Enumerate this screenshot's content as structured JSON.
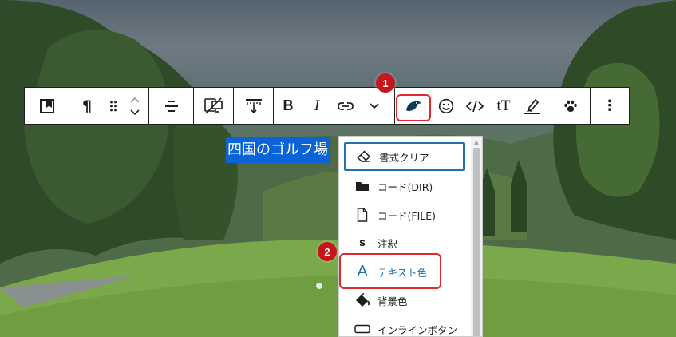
{
  "background": {
    "description_icon": "golf-course-photo"
  },
  "toolbar": {
    "groups": [
      {
        "buttons": [
          {
            "icon": "block-type-icon"
          }
        ]
      },
      {
        "buttons": [
          {
            "icon": "paragraph-icon",
            "label": "¶"
          },
          {
            "icon": "drag-handle-icon"
          },
          {
            "icon": "move-up-down-icon"
          }
        ]
      },
      {
        "buttons": [
          {
            "icon": "align-icon"
          }
        ]
      },
      {
        "buttons": [
          {
            "icon": "device-visibility-icon"
          }
        ]
      },
      {
        "buttons": [
          {
            "icon": "spacing-icon"
          }
        ]
      },
      {
        "buttons": [
          {
            "icon": "bold-icon",
            "label": "B"
          },
          {
            "icon": "italic-icon",
            "label": "I"
          },
          {
            "icon": "link-icon"
          },
          {
            "icon": "chevron-down-icon"
          }
        ]
      },
      {
        "buttons": [
          {
            "icon": "swell-format-icon"
          },
          {
            "icon": "emoji-icon"
          },
          {
            "icon": "code-icon"
          },
          {
            "icon": "font-size-icon",
            "label": "tT"
          },
          {
            "icon": "highlight-icon"
          }
        ]
      },
      {
        "buttons": [
          {
            "icon": "paw-icon"
          }
        ]
      },
      {
        "buttons": [
          {
            "icon": "more-options-icon",
            "label": "⋮"
          }
        ]
      }
    ]
  },
  "badges": {
    "first": "1",
    "second": "2"
  },
  "editor": {
    "selected_text": "四国のゴルフ場"
  },
  "dropdown": {
    "items": [
      {
        "icon": "eraser-icon",
        "label": "書式クリア"
      },
      {
        "icon": "folder-icon",
        "label": "コード(DIR)"
      },
      {
        "icon": "file-icon",
        "label": "コード(FILE)"
      },
      {
        "icon": "s-letter-icon",
        "icon_label": "s",
        "label": "注釈"
      },
      {
        "icon": "text-color-icon",
        "icon_label": "A",
        "label": "テキスト色"
      },
      {
        "icon": "paint-bucket-icon",
        "label": "背景色"
      },
      {
        "icon": "inline-button-icon",
        "label": "インラインボタン"
      }
    ]
  },
  "colors": {
    "accent": "#2271b1",
    "selection": "#0b63d8",
    "annotation_red": "#e0292f",
    "badge_red": "#c6161c"
  }
}
